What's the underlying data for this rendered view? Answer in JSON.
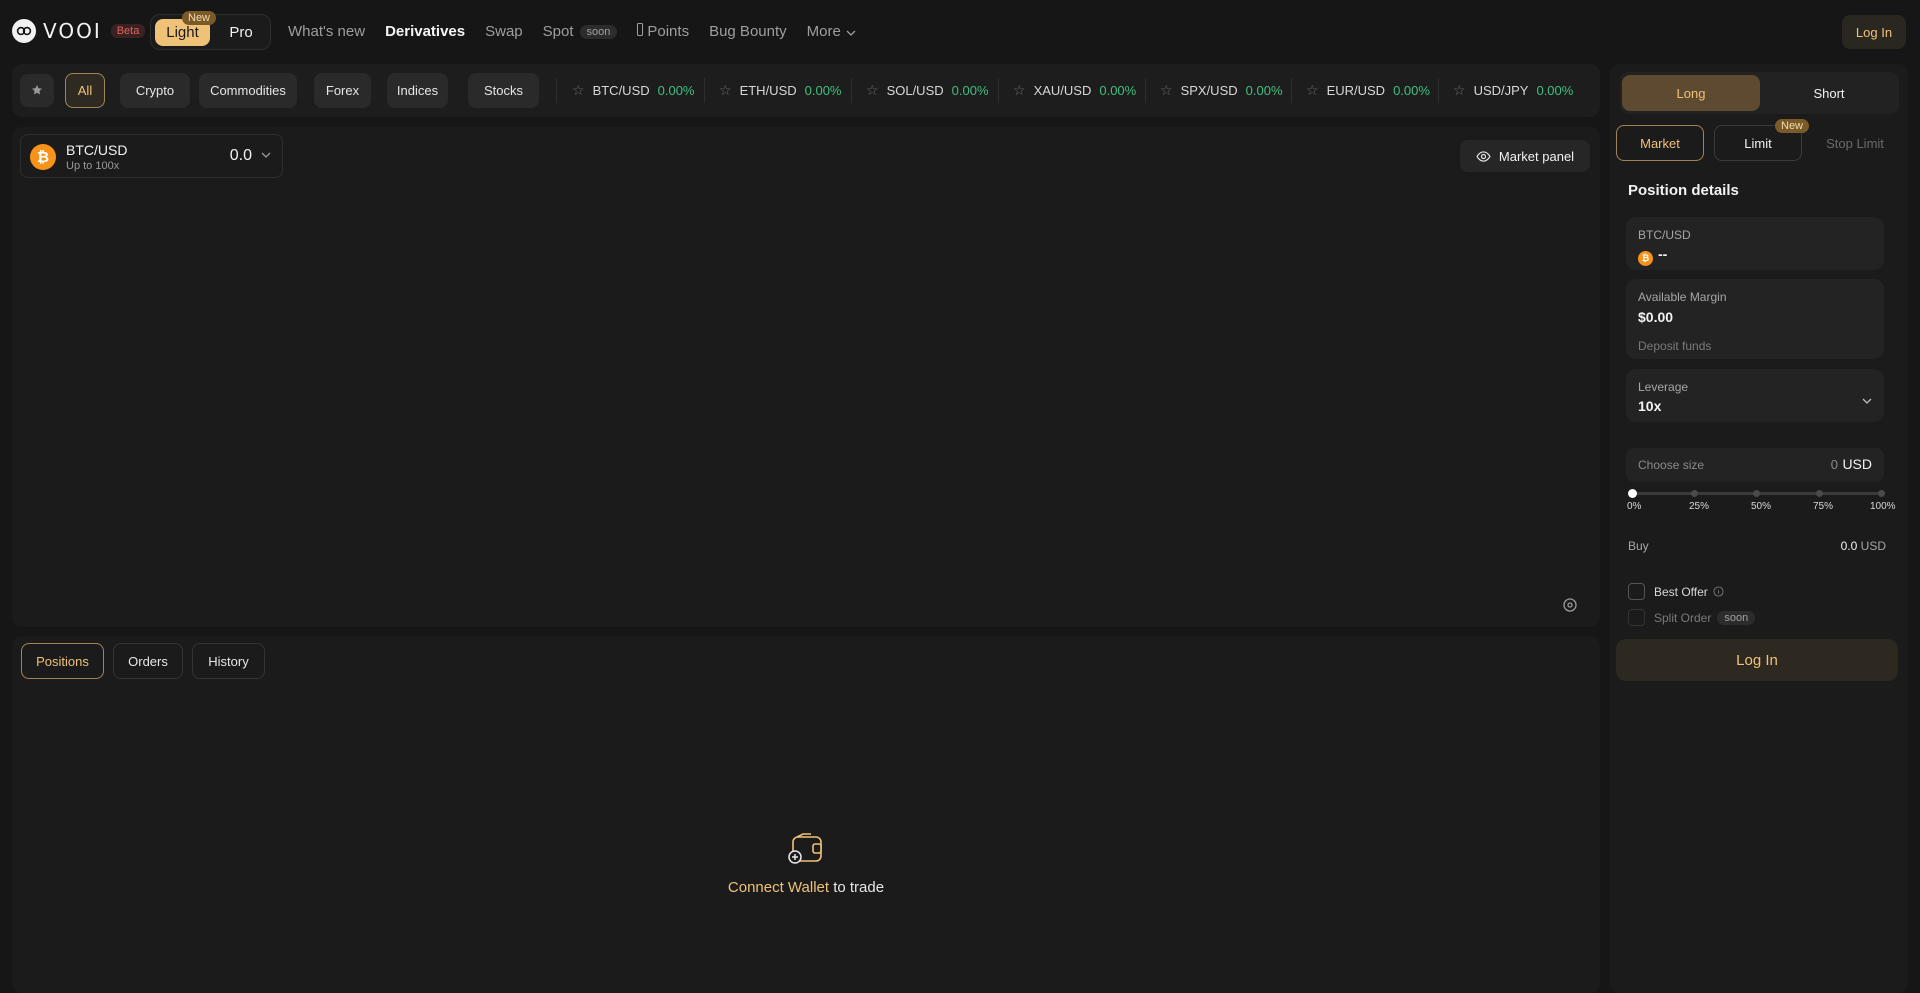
{
  "header": {
    "brand": "VOOI",
    "beta_badge": "Beta",
    "mode": {
      "light": "Light",
      "pro": "Pro",
      "new_badge": "New"
    },
    "nav": {
      "whats_new": "What's new",
      "derivatives": "Derivatives",
      "swap": "Swap",
      "spot": "Spot",
      "spot_badge": "soon",
      "points": "Points",
      "bug_bounty": "Bug Bounty",
      "more": "More"
    },
    "login": "Log In"
  },
  "filters": {
    "categories": [
      "All",
      "Crypto",
      "Commodities",
      "Forex",
      "Indices",
      "Stocks"
    ],
    "active": "All",
    "tickers": [
      {
        "symbol": "BTC/USD",
        "change": "0.00%"
      },
      {
        "symbol": "ETH/USD",
        "change": "0.00%"
      },
      {
        "symbol": "SOL/USD",
        "change": "0.00%"
      },
      {
        "symbol": "XAU/USD",
        "change": "0.00%"
      },
      {
        "symbol": "SPX/USD",
        "change": "0.00%"
      },
      {
        "symbol": "EUR/USD",
        "change": "0.00%"
      },
      {
        "symbol": "USD/JPY",
        "change": "0.00%"
      }
    ]
  },
  "chart": {
    "pair": "BTC/USD",
    "leverage_note": "Up to 100x",
    "price": "0.0",
    "market_panel": "Market panel"
  },
  "positions": {
    "tabs": [
      "Positions",
      "Orders",
      "History"
    ],
    "active_tab": "Positions",
    "empty_link": "Connect Wallet",
    "empty_rest": " to trade"
  },
  "order": {
    "long": "Long",
    "short": "Short",
    "types": {
      "market": "Market",
      "limit": "Limit",
      "stop_limit": "Stop Limit",
      "limit_badge": "New"
    },
    "section_title": "Position details",
    "pair_label": "BTC/USD",
    "pair_value": "--",
    "margin_label": "Available Margin",
    "margin_value": "$0.00",
    "deposit": "Deposit funds",
    "leverage_label": "Leverage",
    "leverage_value": "10x",
    "size_placeholder": "Choose size",
    "size_value": "0",
    "size_unit": "USD",
    "slider_labels": [
      "0%",
      "25%",
      "50%",
      "75%",
      "100%"
    ],
    "slider_value": 0,
    "buy_label": "Buy",
    "buy_value": "0.0",
    "buy_unit": "USD",
    "best_offer": "Best Offer",
    "split_order": "Split Order",
    "split_badge": "soon",
    "login": "Log In"
  },
  "colors": {
    "accent": "#f0c278",
    "positive": "#3ec07e",
    "bitcoin": "#f7931a",
    "background": "#161616",
    "panel": "#1b1b1b"
  }
}
